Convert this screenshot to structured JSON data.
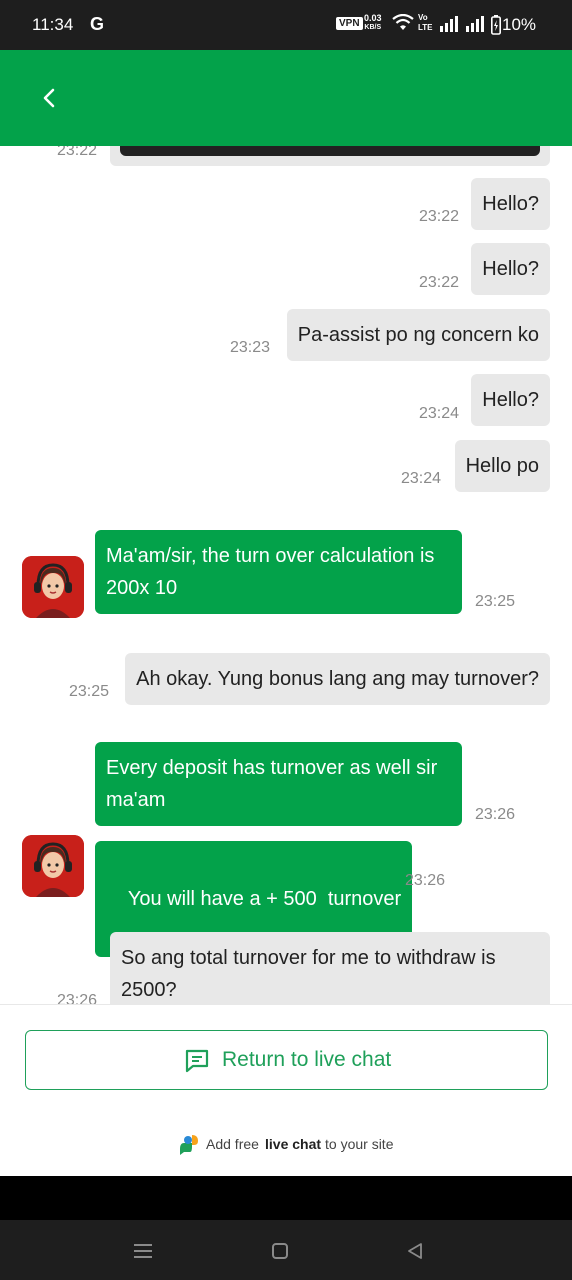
{
  "status_bar": {
    "time": "11:34",
    "g_label": "G",
    "vpn_label": "VPN",
    "speed_value": "0.03",
    "speed_unit": "KB/S",
    "volte_top": "Vo",
    "volte_bottom": "LTE",
    "battery": "10%",
    "bg_color": "#1e1e1e"
  },
  "header": {
    "accent_color": "#03a24a",
    "back_icon": "chevron-left-icon"
  },
  "messages": [
    {
      "sender": "user",
      "time": "23:22",
      "text": "Hello?"
    },
    {
      "sender": "user",
      "time": "23:22",
      "text": "Hello?"
    },
    {
      "sender": "user",
      "time": "23:23",
      "text": "Pa-assist po ng concern ko"
    },
    {
      "sender": "user",
      "time": "23:24",
      "text": "Hello?"
    },
    {
      "sender": "user",
      "time": "23:24",
      "text": "Hello po"
    },
    {
      "sender": "agent",
      "time": "23:25",
      "lines": [
        "Ma'am/sir, the turn over calculation is",
        "200x 10"
      ]
    },
    {
      "sender": "user",
      "time": "23:25",
      "text": "Ah okay. Yung bonus lang ang may turnover?"
    },
    {
      "sender": "agent",
      "time": "23:26",
      "lines": [
        "Every deposit has turnover as well sir",
        "ma'am"
      ]
    },
    {
      "sender": "agent",
      "time": "23:26",
      "text": "You will have a + 500  turnover"
    },
    {
      "sender": "user",
      "time": "23:26",
      "lines": [
        "So ang total turnover for me to withdraw is",
        "2500?"
      ]
    }
  ],
  "partial_top_message_time": "23:22",
  "return_button": {
    "label": "Return to live chat",
    "icon": "chat-bubble-icon"
  },
  "footer": {
    "prefix": "Add free",
    "bold": "live chat",
    "suffix": "to your site",
    "logo_icon": "livechat-logo-icon"
  },
  "nav_bar": {
    "menu_icon": "menu-icon",
    "home_icon": "home-square-icon",
    "back_icon": "back-triangle-icon"
  }
}
